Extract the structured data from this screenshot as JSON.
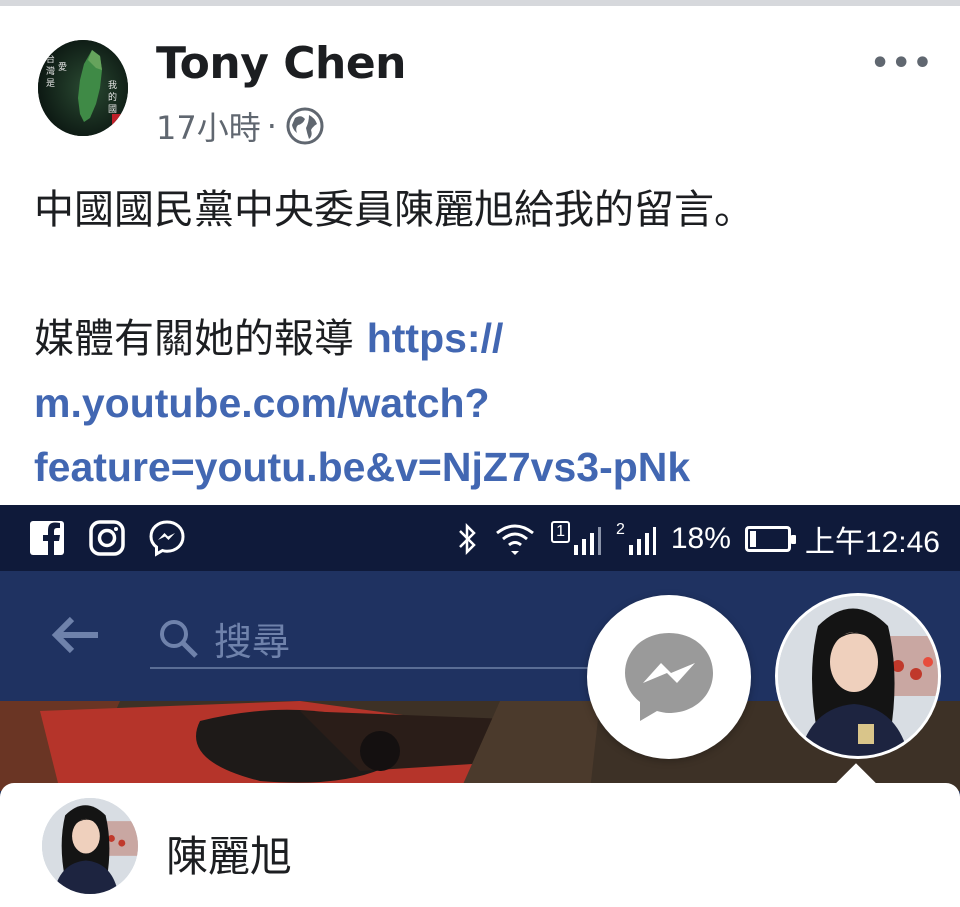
{
  "post": {
    "author": "Tony Chen",
    "time": "17小時",
    "separator": "·",
    "privacy_icon": "globe-icon",
    "more_icon": "more-options-icon",
    "more_label": "•••",
    "avatar_text": "台灣是我的國家 愛台灣",
    "line1": "中國國民黨中央委員陳麗旭給我的留言。",
    "line2_text": "媒體有關她的報導 ",
    "link_line1": "https://",
    "link_line2": "m.youtube.com/watch?",
    "link_line3": "feature=youtu.be&v=NjZ7vs3-pNk"
  },
  "screenshot": {
    "status_bar": {
      "left_icons": [
        "facebook-icon",
        "instagram-icon",
        "messenger-icon"
      ],
      "sim1_label": "1",
      "sim2_label": "2",
      "battery": "18%",
      "battery_level": 0.18,
      "clock": "上午12:46"
    },
    "search": {
      "placeholder": "搜尋"
    },
    "chat_popup": {
      "name": "陳麗旭"
    }
  }
}
